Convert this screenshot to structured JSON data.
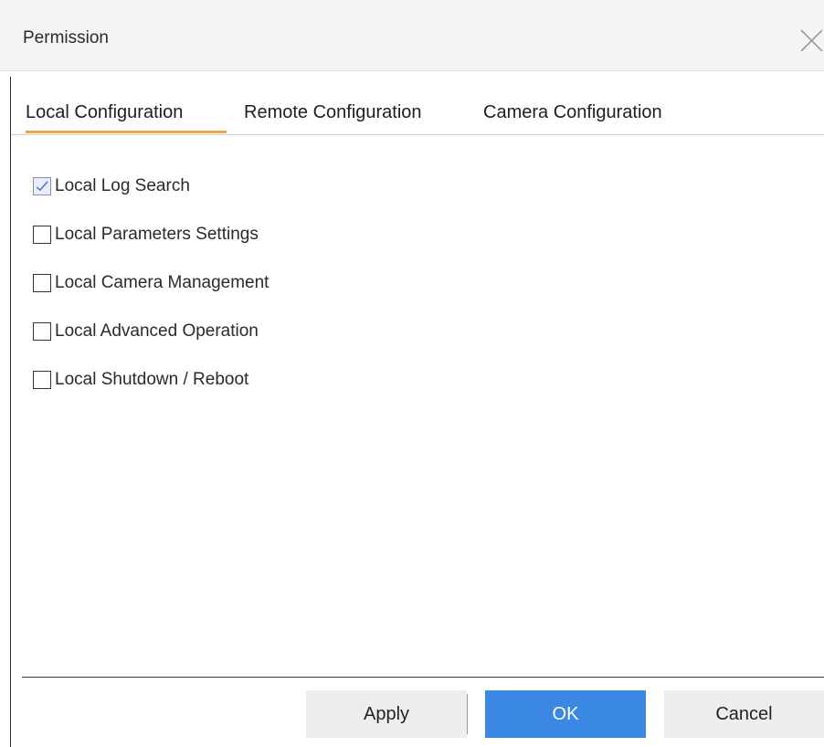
{
  "dialog": {
    "title": "Permission",
    "close_icon": "close-icon"
  },
  "tabs": [
    {
      "label": "Local Configuration",
      "active": true
    },
    {
      "label": "Remote Configuration",
      "active": false
    },
    {
      "label": "Camera Configuration",
      "active": false
    }
  ],
  "permissions": [
    {
      "label": "Local Log Search",
      "checked": true
    },
    {
      "label": "Local Parameters Settings",
      "checked": false
    },
    {
      "label": "Local Camera Management",
      "checked": false
    },
    {
      "label": "Local Advanced Operation",
      "checked": false
    },
    {
      "label": "Local Shutdown / Reboot",
      "checked": false
    }
  ],
  "buttons": {
    "apply": "Apply",
    "ok": "OK",
    "cancel": "Cancel"
  },
  "colors": {
    "accent_tab_underline": "#f0a34c",
    "primary_button": "#3b88e4",
    "secondary_button": "#eeeeee",
    "titlebar_bg": "#f5f5f5"
  }
}
